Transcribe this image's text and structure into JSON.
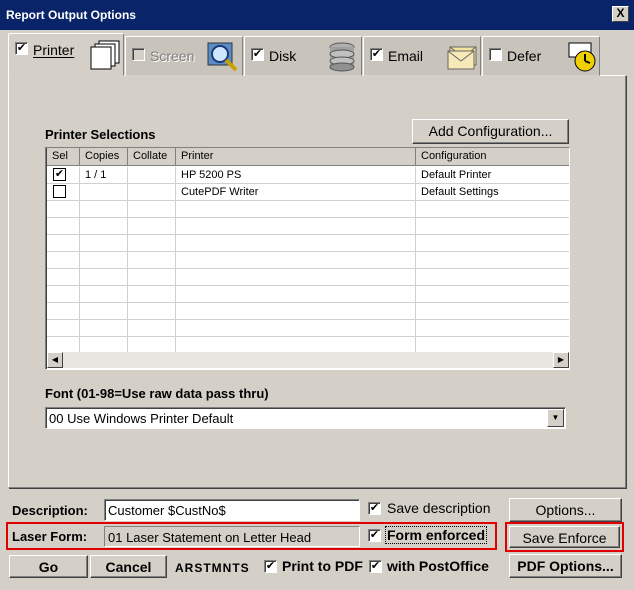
{
  "window": {
    "title": "Report Output Options",
    "close_label": "X"
  },
  "tabs": [
    {
      "label": "Printer",
      "checked": true,
      "enabled": true,
      "icon": "printer-icon"
    },
    {
      "label": "Screen",
      "checked": false,
      "enabled": false,
      "icon": "magnifier-icon"
    },
    {
      "label": "Disk",
      "checked": true,
      "enabled": true,
      "icon": "disk-stack-icon"
    },
    {
      "label": "Email",
      "checked": true,
      "enabled": true,
      "icon": "envelope-icon"
    },
    {
      "label": "Defer",
      "checked": false,
      "enabled": true,
      "icon": "clock-icon"
    }
  ],
  "printer_selections": {
    "heading": "Printer Selections",
    "add_config_label": "Add Configuration...",
    "columns": [
      "Sel",
      "Copies",
      "Collate",
      "Printer",
      "Configuration"
    ],
    "rows": [
      {
        "selected": true,
        "copies": "1 / 1",
        "collate": "",
        "printer": "HP 5200 PS",
        "configuration": "Default Printer"
      },
      {
        "selected": false,
        "copies": "",
        "collate": "",
        "printer": "CutePDF Writer",
        "configuration": "Default Settings"
      }
    ]
  },
  "font": {
    "label": "Font  (01-98=Use raw data pass thru)",
    "value": "00 Use Windows Printer Default"
  },
  "description": {
    "label": "Description:",
    "value": "Customer $CustNo$",
    "save_label": "Save description",
    "save_checked": true,
    "options_label": "Options..."
  },
  "laser_form": {
    "label": "Laser Form:",
    "value": "01 Laser Statement on Letter Head",
    "enforced_label": "Form enforced",
    "enforced_checked": true,
    "save_enforce_label": "Save Enforce"
  },
  "bottom": {
    "go_label": "Go",
    "cancel_label": "Cancel",
    "report_code": "ARSTMNTS",
    "print_pdf_label": "Print to PDF",
    "print_pdf_checked": true,
    "postoffice_label": "with PostOffice",
    "postoffice_checked": true,
    "pdf_options_label": "PDF Options..."
  },
  "colors": {
    "title_bar": "#0a246a",
    "highlight": "#e00000",
    "face": "#d4d0c8"
  }
}
